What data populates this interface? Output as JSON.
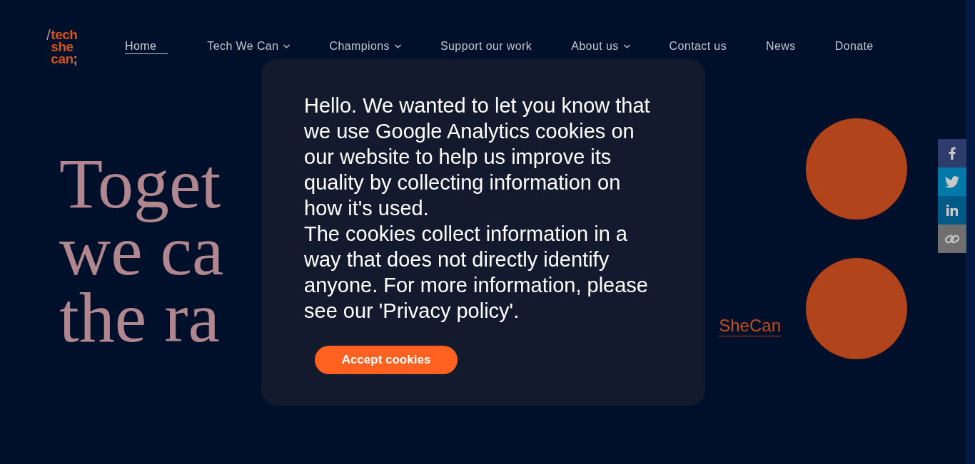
{
  "logo": {
    "slash": "/",
    "lines": [
      "tech",
      "she",
      "can"
    ],
    "end": ";"
  },
  "nav": [
    {
      "label": "Home",
      "selected": true,
      "has_menu": false
    },
    {
      "label": "Tech We Can",
      "selected": false,
      "has_menu": true
    },
    {
      "label": "Champions",
      "selected": false,
      "has_menu": true
    },
    {
      "label": "Support our work",
      "selected": false,
      "has_menu": false
    },
    {
      "label": "About us",
      "selected": false,
      "has_menu": true
    },
    {
      "label": "Contact us",
      "selected": false,
      "has_menu": false
    },
    {
      "label": "News",
      "selected": false,
      "has_menu": false
    },
    {
      "label": "Donate",
      "selected": false,
      "has_menu": false
    }
  ],
  "hero": {
    "heading_lines": [
      "Toget",
      "we ca",
      "the ra"
    ],
    "link": "SheCan"
  },
  "share_buttons": [
    {
      "kind": "facebook",
      "color": "#2d3c6a"
    },
    {
      "kind": "twitter",
      "color": "#0079a9"
    },
    {
      "kind": "linkedin",
      "color": "#005a85"
    },
    {
      "kind": "link",
      "color": "#6f6f6f"
    }
  ],
  "cookie_notice": {
    "paragraphs": [
      "Hello. We wanted to let you know that we use Google Analytics cookies on our website to help us improve its quality by collecting information on how it's used.",
      "The cookies collect information in a way that does not directly identify anyone. For more information, please see our 'Privacy policy'."
    ],
    "button": "Accept cookies"
  }
}
